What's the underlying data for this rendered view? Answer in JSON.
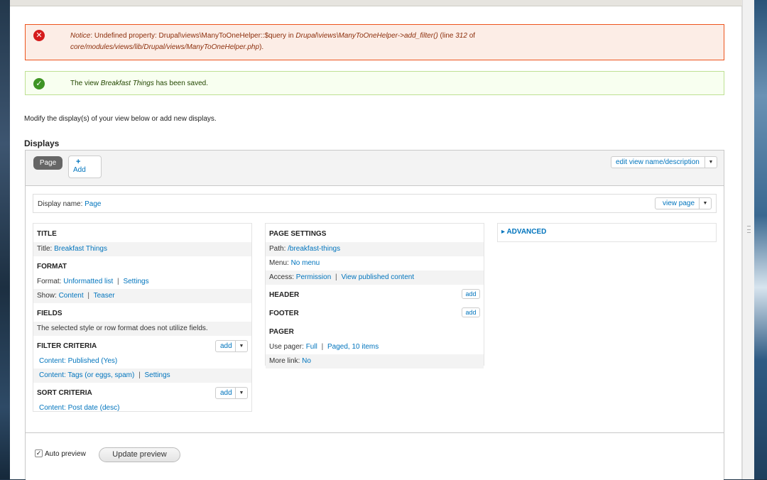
{
  "notice": {
    "prefix": "Notice",
    "text_1": ": Undefined property: Drupal\\views\\ManyToOneHelper::$query in ",
    "class_method": "Drupal\\views\\ManyToOneHelper->add_filter()",
    "line_label": " (line ",
    "line_num": "312",
    "of_word": " of",
    "file": "core/modules/views/lib/Drupal/views/ManyToOneHelper.php",
    "end": ")."
  },
  "status": {
    "pre": "The view ",
    "view_name": "Breakfast Things",
    "post": " has been saved."
  },
  "intro": "Modify the display(s) of your view below or add new displays.",
  "displays_heading": "Displays",
  "tabs": {
    "page_tab": "Page",
    "add_plus": "+",
    "add_label": "Add"
  },
  "edit_view_btn": "edit view name/description",
  "display_name": {
    "label": "Display name:",
    "value": "Page"
  },
  "view_page_btn": "view page",
  "column1": {
    "title_heading": "TITLE",
    "title_label": "Title:",
    "title_value": "Breakfast Things",
    "format_heading": "FORMAT",
    "format_label": "Format:",
    "format_value": "Unformatted list",
    "format_settings": "Settings",
    "show_label": "Show:",
    "show_value": "Content",
    "show_teaser": "Teaser",
    "fields_heading": "FIELDS",
    "fields_note": "The selected style or row format does not utilize fields.",
    "filter_heading": "FILTER CRITERIA",
    "filter_add": "add",
    "filter_1": "Content: Published (Yes)",
    "filter_2": "Content: Tags (or eggs, spam)",
    "filter_2_settings": "Settings",
    "sort_heading": "SORT CRITERIA",
    "sort_add": "add",
    "sort_1": "Content: Post date (desc)"
  },
  "column2": {
    "page_settings_heading": "PAGE SETTINGS",
    "path_label": "Path:",
    "path_value": "/breakfast-things",
    "menu_label": "Menu:",
    "menu_value": "No menu",
    "access_label": "Access:",
    "access_value": "Permission",
    "access_value_2": "View published content",
    "header_heading": "HEADER",
    "header_add": "add",
    "footer_heading": "FOOTER",
    "footer_add": "add",
    "pager_heading": "PAGER",
    "use_pager_label": "Use pager:",
    "use_pager_value": "Full",
    "use_pager_value_2": "Paged, 10 items",
    "more_link_label": "More link:",
    "more_link_value": "No"
  },
  "column3": {
    "advanced_arrow": "▸",
    "advanced_heading": "ADVANCED"
  },
  "preview": {
    "auto_preview_label": "Auto preview",
    "auto_preview_checked": true,
    "update_label": "Update preview"
  },
  "icons": {
    "dropdown": "▼",
    "separator": "|",
    "check": "✓",
    "error": "✕"
  },
  "colors": {
    "link": "#0074bd",
    "error_border": "#ed541d",
    "status_border": "#bee093"
  }
}
